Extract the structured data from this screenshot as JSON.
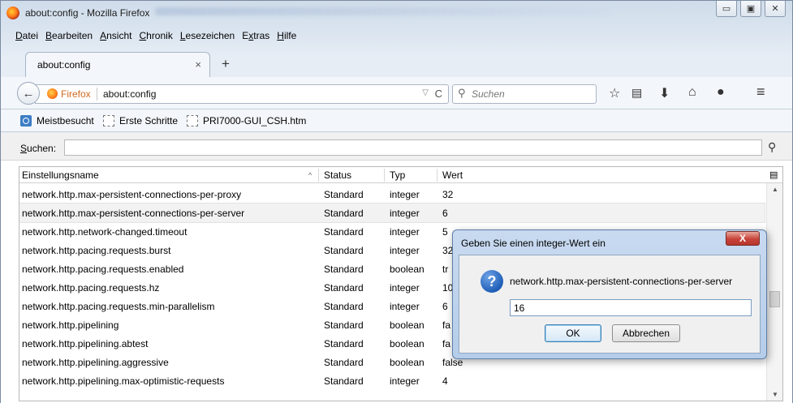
{
  "window": {
    "title": "about:config - Mozilla Firefox",
    "controls": {
      "minimize": "▭",
      "maximize": "▣",
      "close": "✕"
    }
  },
  "menubar": [
    {
      "underlined": "D",
      "rest": "atei"
    },
    {
      "underlined": "B",
      "rest": "earbeiten"
    },
    {
      "underlined": "A",
      "rest": "nsicht"
    },
    {
      "underlined": "C",
      "rest": "hronik"
    },
    {
      "underlined": "L",
      "rest": "esezeichen"
    },
    {
      "underlined": "x",
      "prefix": "E",
      "rest": "tras"
    },
    {
      "underlined": "H",
      "rest": "ilfe"
    }
  ],
  "tab": {
    "label": "about:config",
    "close": "×",
    "new_tab": "+"
  },
  "navbar": {
    "back": "←",
    "identity_label": "Firefox",
    "url": "about:config",
    "dropdown": "▽",
    "reload": "C",
    "search_placeholder": "Suchen",
    "icons": [
      "star-icon",
      "reading-list-icon",
      "download-icon",
      "home-icon",
      "chat-icon",
      "menu-icon"
    ]
  },
  "bookmarks": [
    {
      "label": "Meistbesucht",
      "icon": "bookmark-folder-icon"
    },
    {
      "label": "Erste Schritte",
      "icon": "page-icon"
    },
    {
      "label": "PRI7000-GUI_CSH.htm",
      "icon": "page-icon"
    }
  ],
  "config_search": {
    "label_u": "S",
    "label_rest": "uchen:",
    "value": ""
  },
  "table": {
    "columns": [
      "Einstellungsname",
      "Status",
      "Typ",
      "Wert"
    ],
    "sort_indicator": "^",
    "rows": [
      {
        "name": "network.http.max-persistent-connections-per-proxy",
        "status": "Standard",
        "type": "integer",
        "value": "32"
      },
      {
        "name": "network.http.max-persistent-connections-per-server",
        "status": "Standard",
        "type": "integer",
        "value": "6",
        "selected": true
      },
      {
        "name": "network.http.network-changed.timeout",
        "status": "Standard",
        "type": "integer",
        "value": "5"
      },
      {
        "name": "network.http.pacing.requests.burst",
        "status": "Standard",
        "type": "integer",
        "value": "32"
      },
      {
        "name": "network.http.pacing.requests.enabled",
        "status": "Standard",
        "type": "boolean",
        "value": "tr"
      },
      {
        "name": "network.http.pacing.requests.hz",
        "status": "Standard",
        "type": "integer",
        "value": "10"
      },
      {
        "name": "network.http.pacing.requests.min-parallelism",
        "status": "Standard",
        "type": "integer",
        "value": "6"
      },
      {
        "name": "network.http.pipelining",
        "status": "Standard",
        "type": "boolean",
        "value": "fa"
      },
      {
        "name": "network.http.pipelining.abtest",
        "status": "Standard",
        "type": "boolean",
        "value": "fa"
      },
      {
        "name": "network.http.pipelining.aggressive",
        "status": "Standard",
        "type": "boolean",
        "value": "false"
      },
      {
        "name": "network.http.pipelining.max-optimistic-requests",
        "status": "Standard",
        "type": "integer",
        "value": "4"
      }
    ]
  },
  "dialog": {
    "title": "Geben Sie einen integer-Wert ein",
    "close": "X",
    "icon": "?",
    "prompt": "network.http.max-persistent-connections-per-server",
    "input_value": "16",
    "ok": "OK",
    "cancel": "Abbrechen"
  }
}
